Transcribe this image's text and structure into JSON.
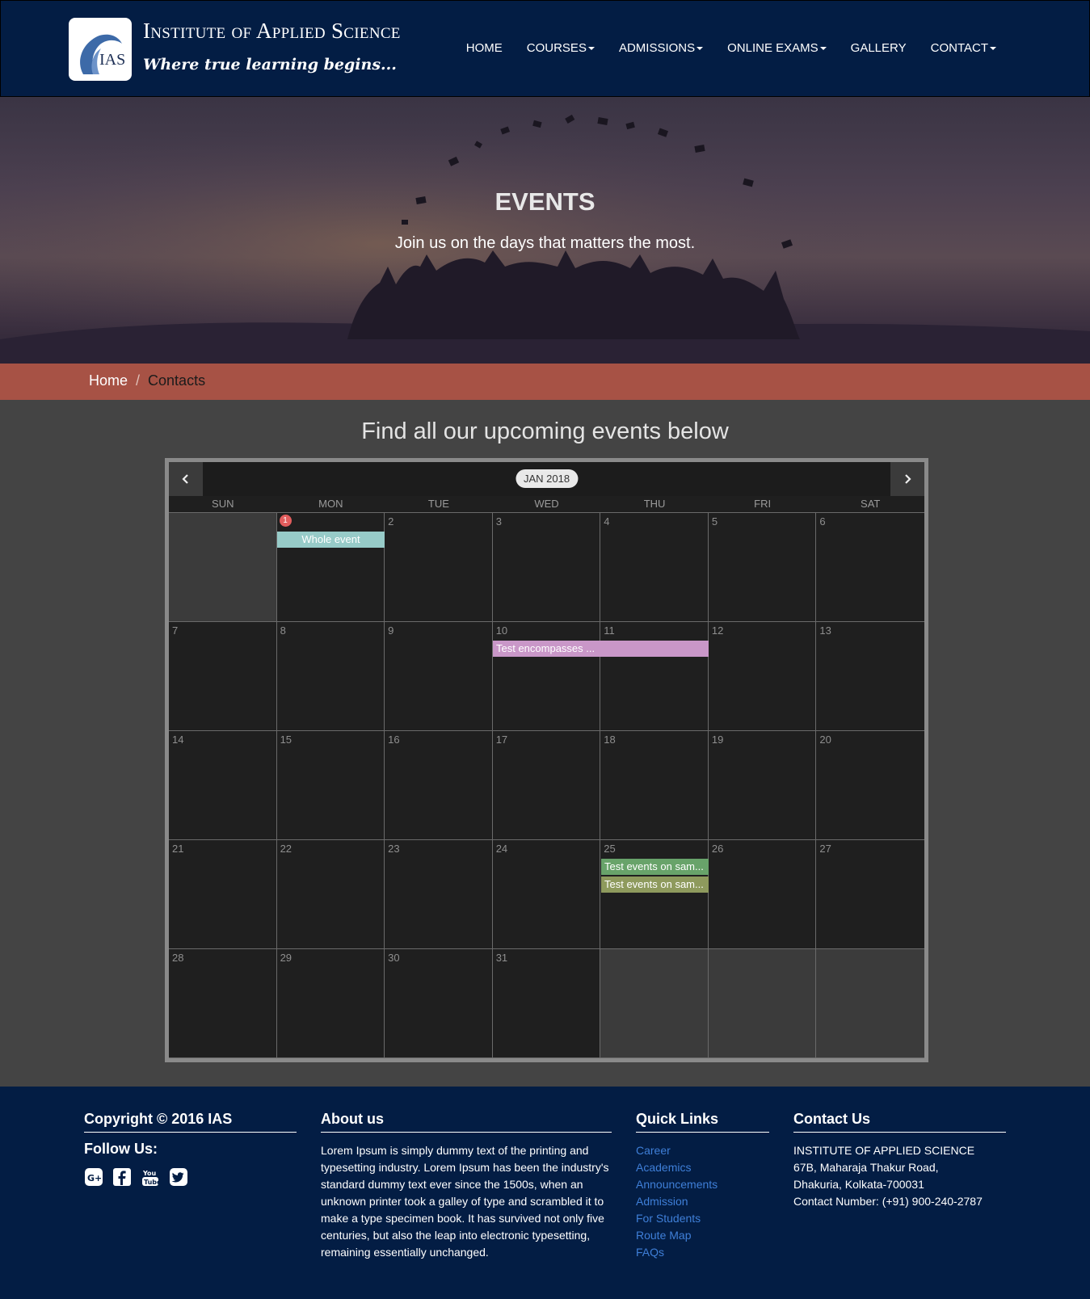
{
  "brand": {
    "logo_text": "IAS",
    "title": "Institute of Applied Science",
    "tagline": "Where true learning begins..."
  },
  "nav": {
    "home": "HOME",
    "courses": "COURSES",
    "admissions": "ADMISSIONS",
    "online_exams": "ONLINE EXAMS",
    "gallery": "GALLERY",
    "contact": "CONTACT"
  },
  "hero": {
    "title": "EVENTS",
    "subtitle": "Join us on the days that matters the most."
  },
  "breadcrumb": {
    "home": "Home",
    "separator": "/",
    "current": "Contacts"
  },
  "section_title": "Find all our upcoming events below",
  "calendar": {
    "month_label": "JAN 2018",
    "prev_icon": "chevron-left-icon",
    "next_icon": "chevron-right-icon",
    "weekdays": [
      "SUN",
      "MON",
      "TUE",
      "WED",
      "THU",
      "FRI",
      "SAT"
    ],
    "weeks": [
      [
        "",
        "1",
        "2",
        "3",
        "4",
        "5",
        "6"
      ],
      [
        "7",
        "8",
        "9",
        "10",
        "11",
        "12",
        "13"
      ],
      [
        "14",
        "15",
        "16",
        "17",
        "18",
        "19",
        "20"
      ],
      [
        "21",
        "22",
        "23",
        "24",
        "25",
        "26",
        "27"
      ],
      [
        "28",
        "29",
        "30",
        "31",
        "",
        "",
        ""
      ]
    ],
    "badge_count": "1",
    "events": [
      {
        "label": "Whole event",
        "date": "Jan 1",
        "color": "#97cbc8"
      },
      {
        "label": "Test encompasses ...",
        "date": "Jan 10 - Jan 11",
        "color": "#c997c8"
      },
      {
        "label": "Test events on sam...",
        "date": "Jan 25",
        "color": "#68a36a"
      },
      {
        "label": "Test events on sam...",
        "date": "Jan 25",
        "color": "#8e9a5d"
      }
    ]
  },
  "footer": {
    "copyright": "Copyright © 2016 IAS",
    "follow_us": "Follow Us:",
    "social_icons": [
      "google-plus-icon",
      "facebook-icon",
      "youtube-icon",
      "twitter-icon"
    ],
    "about_heading": "About us",
    "about_text": "Lorem Ipsum is simply dummy text of the printing and typesetting industry. Lorem Ipsum has been the industry's standard dummy text ever since the 1500s, when an unknown printer took a galley of type and scrambled it to make a type specimen book. It has survived not only five centuries, but also the leap into electronic typesetting, remaining essentially unchanged.",
    "links_heading": "Quick Links",
    "links": [
      "Career",
      "Academics",
      "Announcements",
      "Admission",
      "For Students",
      "Route Map",
      "FAQs"
    ],
    "contact_heading": "Contact Us",
    "contact_lines": [
      "INSTITUTE OF APPLIED SCIENCE",
      "67B, Maharaja Thakur Road,",
      "Dhakuria, Kolkata-700031",
      "Contact Number: (+91) 900-240-2787"
    ]
  },
  "colors": {
    "navbar_bg": "#031d44",
    "breadcrumb_bg": "#a75245",
    "page_bg": "#444444",
    "link_blue": "#3f7fd8"
  }
}
